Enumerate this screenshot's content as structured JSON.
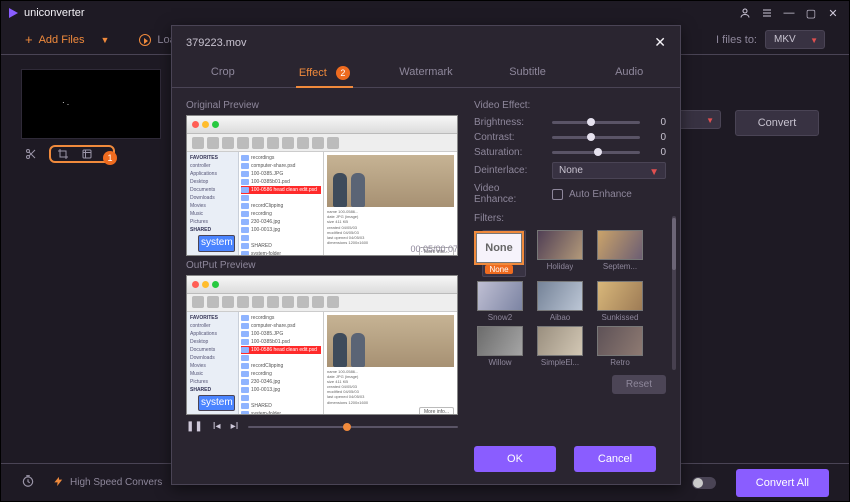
{
  "app": {
    "name": "uniconverter"
  },
  "window_controls": {
    "user": "user-icon",
    "menu": "menu-icon"
  },
  "toolbar": {
    "add_files": "Add Files",
    "load": "Load",
    "convert_files_to_label": "I files to:",
    "format": "MKV",
    "convert": "Convert"
  },
  "thumb": {
    "badge1": "1"
  },
  "modal": {
    "filename": "379223.mov",
    "tabs": {
      "crop": "Crop",
      "effect": "Effect",
      "effect_badge": "2",
      "watermark": "Watermark",
      "subtitle": "Subtitle",
      "audio": "Audio"
    },
    "original_label": "Original Preview",
    "output_label": "OutPut Preview",
    "output_timecode": "00:05/00:07",
    "right": {
      "video_effect": "Video Effect:",
      "brightness": {
        "label": "Brightness:",
        "value": 0
      },
      "contrast": {
        "label": "Contrast:",
        "value": 0
      },
      "saturation": {
        "label": "Saturation:",
        "value": 0
      },
      "deinterlace_label": "Deinterlace:",
      "deinterlace_value": "None",
      "video_enhance": "Video Enhance:",
      "auto_enhance": "Auto Enhance",
      "filters_label": "Filters:",
      "filters": [
        {
          "name": "None",
          "selected": true,
          "cls": "none"
        },
        {
          "name": "Holiday",
          "cls": "thumb-grad-a"
        },
        {
          "name": "Septem...",
          "cls": "thumb-grad-b"
        },
        {
          "name": "Snow2",
          "cls": "thumb-grad-c"
        },
        {
          "name": "Aibao",
          "cls": "thumb-grad-d"
        },
        {
          "name": "Sunkissed",
          "cls": "thumb-grad-e"
        },
        {
          "name": "Willow",
          "cls": "thumb-grad-f"
        },
        {
          "name": "SimpleEl...",
          "cls": "thumb-grad-g"
        },
        {
          "name": "Retro",
          "cls": "thumb-grad-h"
        }
      ],
      "reset": "Reset"
    },
    "buttons": {
      "ok": "OK",
      "cancel": "Cancel"
    }
  },
  "bottom": {
    "high_speed": "High Speed Convers",
    "convert_all": "Convert All"
  },
  "mac_preview": {
    "side": [
      "FAVORITES",
      "controller",
      "Applications",
      "Desktop",
      "Documents",
      "Downloads",
      "Movies",
      "Music",
      "Pictures",
      "SHARED",
      "system"
    ],
    "side_selected_index": 10,
    "center": [
      {
        "t": "recordings"
      },
      {
        "t": "computer-share.psd"
      },
      {
        "t": "100-0385.JPG"
      },
      {
        "t": "100-0385b01.psd"
      },
      {
        "t": "100-0586 head clean edit.psd",
        "red": true
      },
      {
        "t": ""
      },
      {
        "t": "recordClipping"
      },
      {
        "t": "recording"
      },
      {
        "t": "230-0346.jpg"
      },
      {
        "t": "100-0013.jpg"
      },
      {
        "t": ""
      },
      {
        "t": "SHARED"
      },
      {
        "t": "system-folder"
      }
    ],
    "meta_lines": [
      "name  100-0586...",
      "date  JPG (image)",
      "size  411 KB",
      "created  04/05/03",
      "modified  04/05/03",
      "last opened 04/05/03",
      "dimensions  1200x1600"
    ],
    "more": "More info..."
  }
}
